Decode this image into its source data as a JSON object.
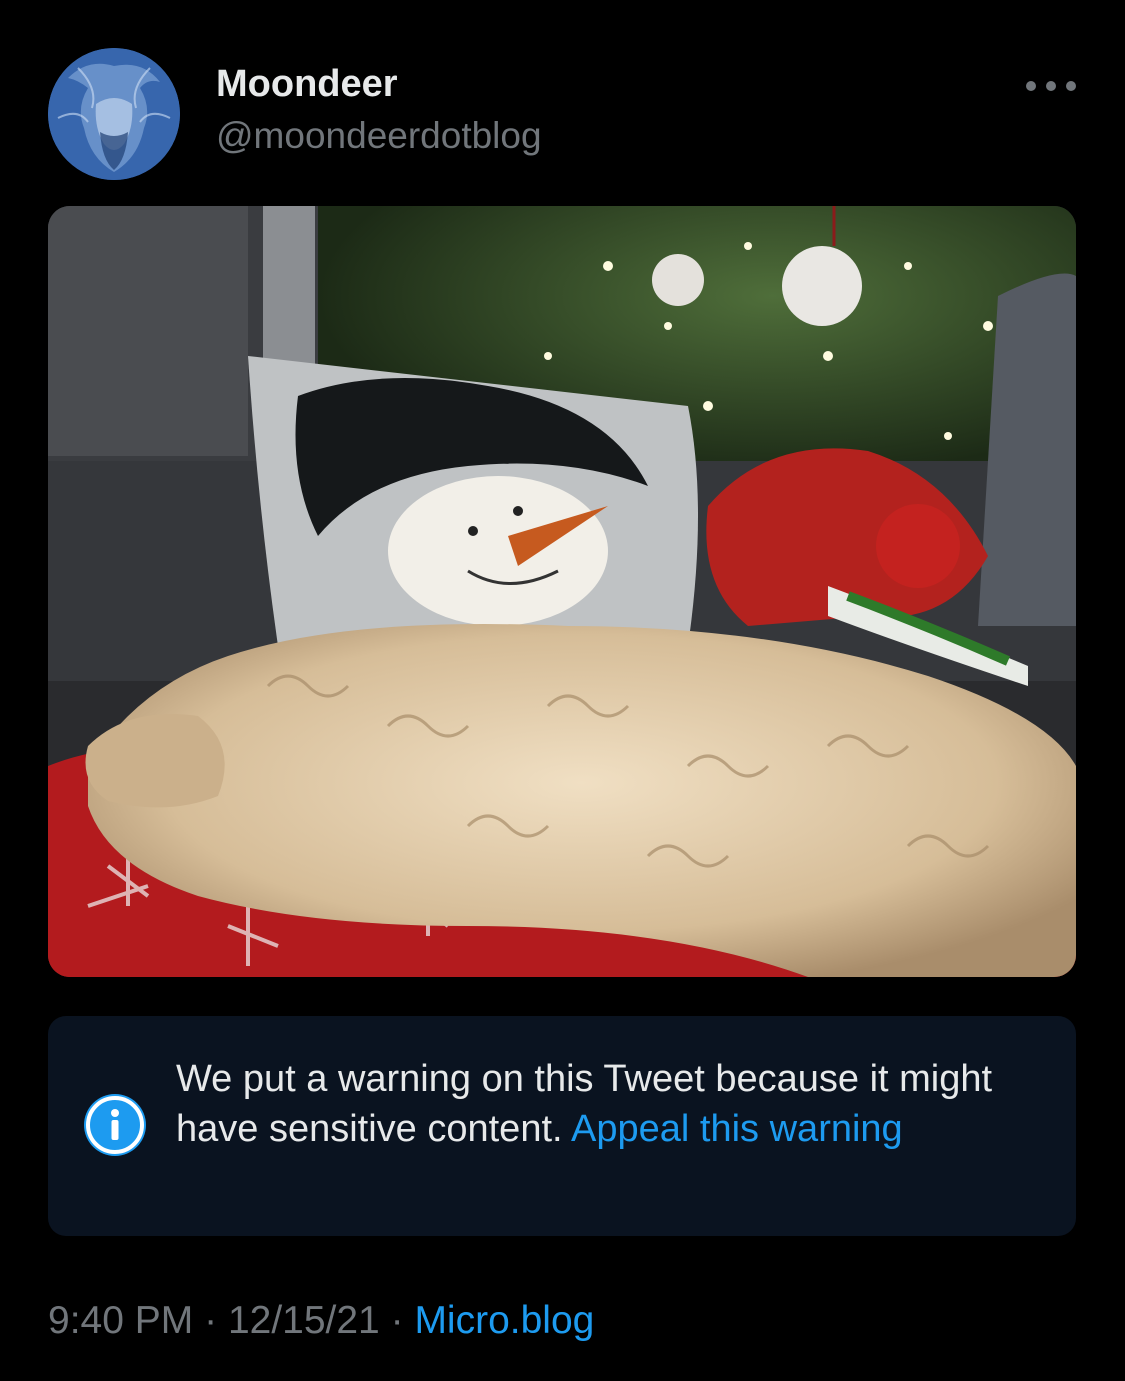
{
  "tweet": {
    "author": {
      "display_name": "Moondeer",
      "handle": "@moondeerdotblog"
    },
    "more_icon": "more-horizontal-icon",
    "media": {
      "type": "photo"
    },
    "warning": {
      "icon": "info-icon",
      "icon_glyph": "i",
      "text": "We put a warning on this Tweet because it might have sensitive content.",
      "link_label": "Appeal this warning"
    },
    "meta": {
      "time": "9:40 PM",
      "separator": "·",
      "date": "12/15/21",
      "source": "Micro.blog"
    }
  },
  "colors": {
    "background": "#000000",
    "primary_text": "#e7e9ea",
    "secondary_text": "#71767b",
    "accent": "#1d9bf0",
    "warning_bg": "#0a1320"
  }
}
